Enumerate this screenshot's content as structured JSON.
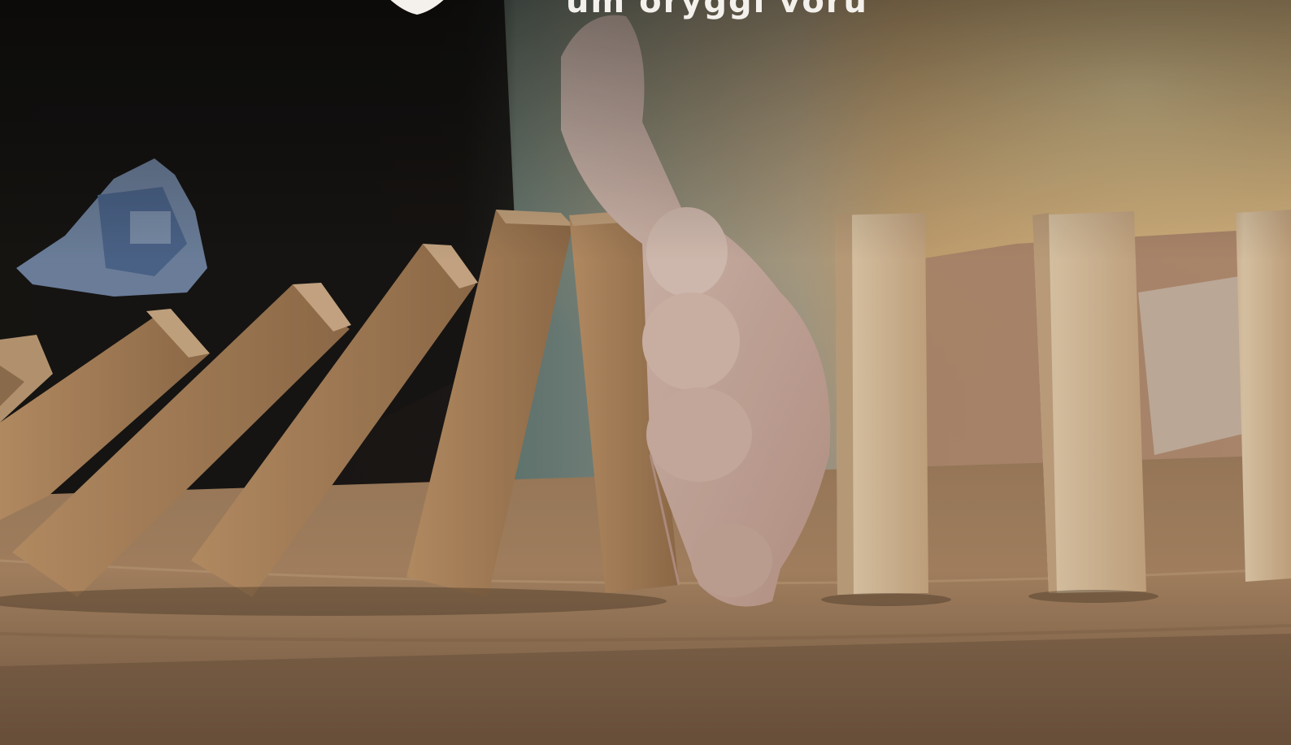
{
  "image": {
    "subject": "hand-stopping-falling-dominoes",
    "headline_text": "um öryggi vöru",
    "logo_icon": "shield-logo-icon"
  },
  "colors": {
    "table_wood": "#b48b66",
    "block_light": "#d9b48b",
    "block_dark": "#8d6a47",
    "hand_skin": "#e3c7b8",
    "background_dark": "#1d1815",
    "background_warm": "#e7b77a"
  }
}
